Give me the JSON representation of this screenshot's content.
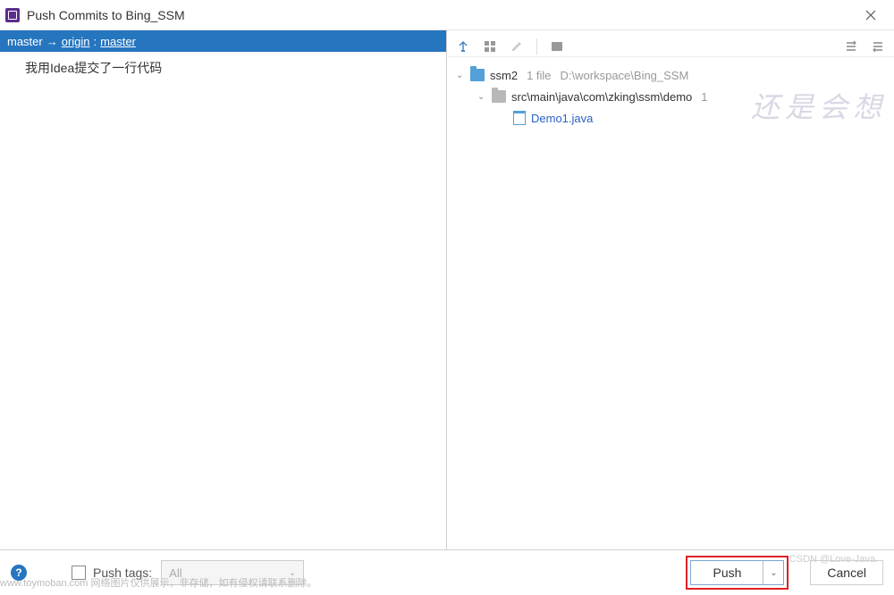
{
  "window": {
    "title": "Push Commits to Bing_SSM"
  },
  "branch": {
    "local": "master",
    "remote_name": "origin",
    "remote_branch": "master"
  },
  "commits": [
    {
      "message": "我用Idea提交了一行代码"
    }
  ],
  "tree": {
    "root": {
      "name": "ssm2",
      "meta": "1 file",
      "path": "D:\\workspace\\Bing_SSM"
    },
    "folder": {
      "path": "src\\main\\java\\com\\zking\\ssm\\demo",
      "meta": "1"
    },
    "file": {
      "name": "Demo1.java"
    }
  },
  "bottom": {
    "push_tags_label": "Push tags:",
    "tags_select_value": "All",
    "push_button": "Push",
    "cancel_button": "Cancel"
  },
  "watermarks": {
    "chinese": "还是会想",
    "bottom_left": "www.toymoban.com 网络图片仅供展示，非存储，如有侵权请联系删除。",
    "bottom_right": "CSDN @Love-Java."
  }
}
